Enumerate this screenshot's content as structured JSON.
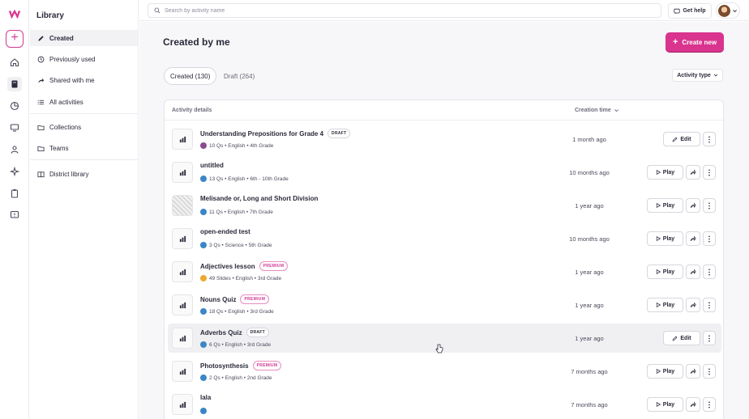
{
  "colors": {
    "brand": "#d9348e",
    "accent_pink": "#d23a94",
    "text": "#292a3a",
    "muted": "#6d6d7e"
  },
  "rail": {
    "icons": [
      "logo-icon",
      "add-icon",
      "home-icon",
      "library-icon",
      "reports-icon",
      "classes-icon",
      "students-icon",
      "ai-icon",
      "clipboard-icon",
      "feedback-icon"
    ]
  },
  "sidebar": {
    "title": "Library",
    "items": [
      {
        "label": "Created",
        "icon": "pencil-icon"
      },
      {
        "label": "Previously used",
        "icon": "clock-icon"
      },
      {
        "label": "Shared with me",
        "icon": "share-icon"
      },
      {
        "label": "All activities",
        "icon": "list-icon"
      },
      {
        "label": "Collections",
        "icon": "folder-icon"
      },
      {
        "label": "Teams",
        "icon": "folder-icon"
      },
      {
        "label": "District library",
        "icon": "building-icon"
      }
    ]
  },
  "topbar": {
    "search_placeholder": "Search by activity name",
    "help_label": "Get help"
  },
  "main": {
    "title": "Created by me",
    "create_label": "Create new",
    "tabs": [
      {
        "label": "Created (130)"
      },
      {
        "label": "Draft (264)"
      }
    ],
    "filter_label": "Activity type",
    "columns": {
      "details": "Activity details",
      "time": "Creation time"
    }
  },
  "actions": {
    "edit": "Edit",
    "play": "Play"
  },
  "rows": [
    {
      "title": "Understanding Prepositions for Grade 4",
      "badge": "DRAFT",
      "meta": "10 Qs • English • 4th Grade",
      "time": "1 month ago",
      "mode": "edit",
      "avatar_color": "#8a4b8f"
    },
    {
      "title": "untitled",
      "badge": "",
      "meta": "13 Qs • English • 6th - 10th Grade",
      "time": "10 months ago",
      "mode": "play",
      "avatar_color": "#3a86c8"
    },
    {
      "title": "Melisande or, Long and Short Division",
      "badge": "",
      "meta": "11 Qs • English • 7th Grade",
      "time": "1 year ago",
      "mode": "play",
      "avatar_color": "#3a86c8"
    },
    {
      "title": "open-ended test",
      "badge": "",
      "meta": "3 Qs • Science • 5th Grade",
      "time": "10 months ago",
      "mode": "play",
      "avatar_color": "#3a86c8"
    },
    {
      "title": "Adjectives lesson",
      "badge": "PREMIUM",
      "meta": "49 Slides • English • 3rd Grade",
      "time": "1 year ago",
      "mode": "play",
      "avatar_color": "#f0a830"
    },
    {
      "title": "Nouns Quiz",
      "badge": "PREMIUM",
      "meta": "18 Qs • English • 3rd Grade",
      "time": "1 year ago",
      "mode": "play",
      "avatar_color": "#3a86c8"
    },
    {
      "title": "Adverbs Quiz",
      "badge": "DRAFT",
      "meta": "6 Qs • English • 3rd Grade",
      "time": "1 year ago",
      "mode": "edit",
      "avatar_color": "#3a86c8"
    },
    {
      "title": "Photosynthesis",
      "badge": "PREMIUM",
      "meta": "2 Qs • English • 2nd Grade",
      "time": "7 months ago",
      "mode": "play",
      "avatar_color": "#3a86c8"
    },
    {
      "title": "lala",
      "badge": "",
      "meta": "",
      "time": "7 months ago",
      "mode": "play",
      "avatar_color": "#3a86c8"
    }
  ]
}
